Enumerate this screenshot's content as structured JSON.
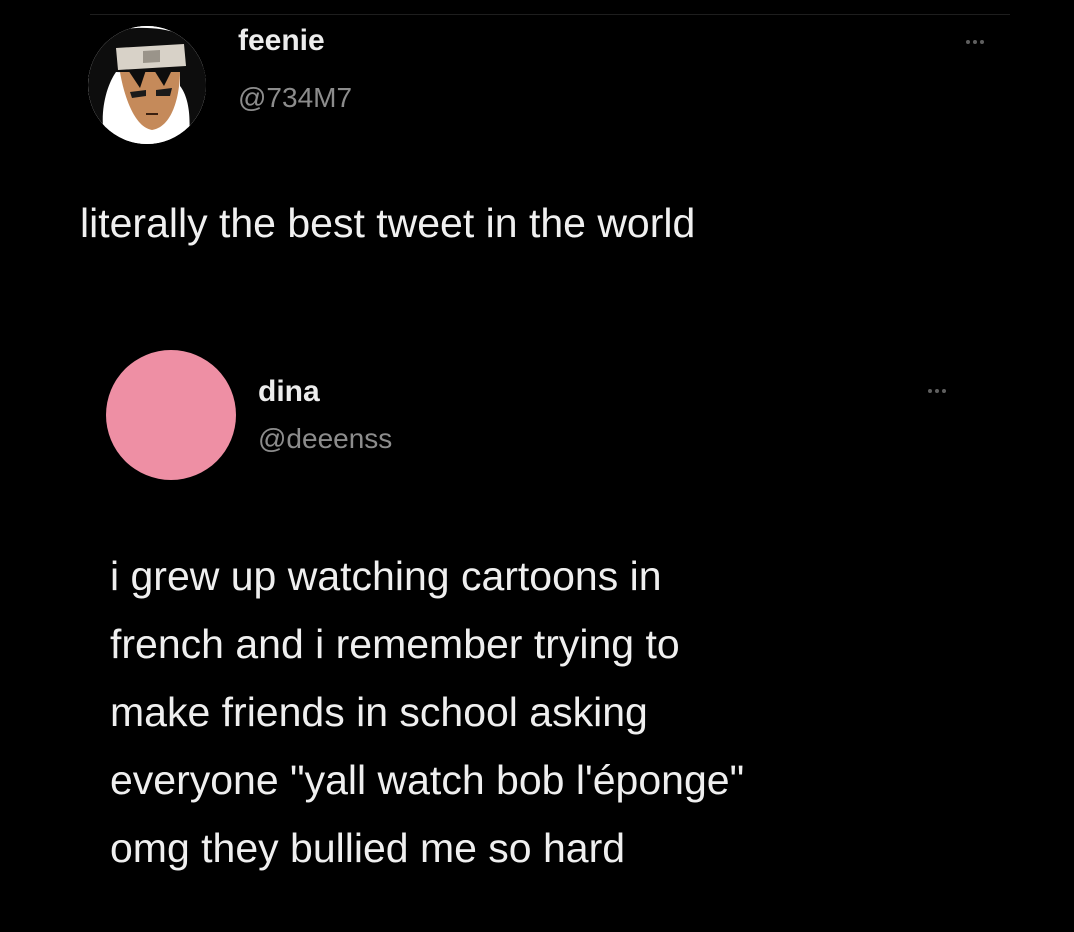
{
  "tweet": {
    "author": {
      "name": "feenie",
      "handle": "@734M7",
      "avatar_icon": "anime-character-avatar"
    },
    "more_icon": "more-options-icon",
    "text": "literally the best tweet in the world",
    "quoted_tweet": {
      "author": {
        "name": "dina",
        "handle": "@deeenss",
        "avatar_color": "#ee8fa4"
      },
      "more_icon": "more-options-icon",
      "text_lines": [
        "i grew up watching cartoons in",
        "french and i remember trying to",
        "make friends in school asking",
        "everyone \"yall watch bob l'éponge\"",
        "omg they bullied me so hard"
      ]
    }
  },
  "colors": {
    "background": "#000000",
    "text_primary": "#ececec",
    "text_secondary": "#8c8c8c"
  }
}
